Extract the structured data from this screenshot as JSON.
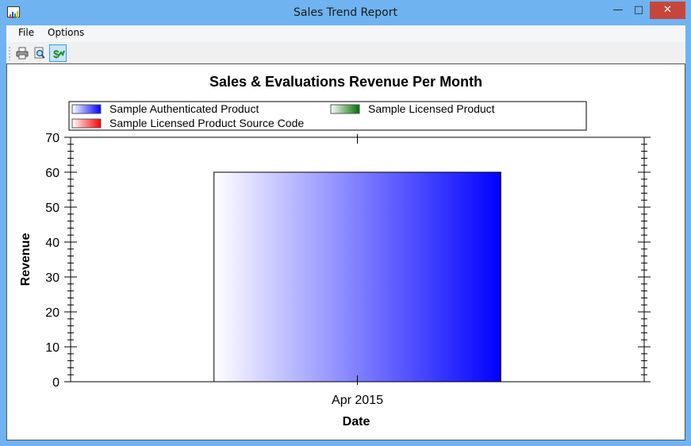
{
  "window": {
    "title": "Sales Trend Report",
    "controls": {
      "minimize": "—",
      "maximize": "□",
      "close": "✕"
    }
  },
  "menu": {
    "file": "File",
    "options": "Options"
  },
  "toolbar": {
    "buttons": [
      {
        "icon": "printer-icon"
      },
      {
        "icon": "print-preview-icon"
      },
      {
        "icon": "sales-report-icon"
      }
    ]
  },
  "chart_data": {
    "type": "bar",
    "title": "Sales & Evaluations Revenue Per Month",
    "xlabel": "Date",
    "ylabel": "Revenue",
    "categories": [
      "Apr 2015"
    ],
    "series": [
      {
        "name": "Sample Authenticated Product",
        "values": [
          60
        ],
        "color": "#0000ff"
      },
      {
        "name": "Sample Licensed Product",
        "values": [
          0
        ],
        "color": "#007000"
      },
      {
        "name": "Sample Licensed Product Source Code",
        "values": [
          0
        ],
        "color": "#ff0000"
      }
    ],
    "ylim": [
      0,
      70
    ],
    "yticks": [
      0,
      10,
      20,
      30,
      40,
      50,
      60,
      70
    ],
    "grid": false,
    "legend_position": "top"
  }
}
